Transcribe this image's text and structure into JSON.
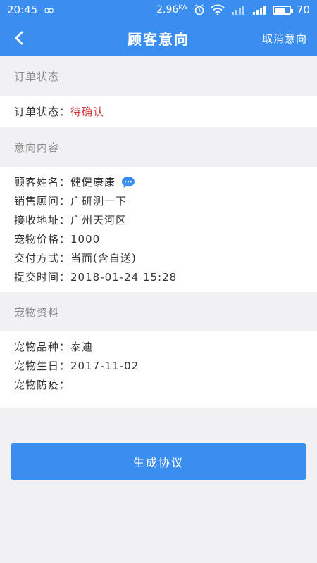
{
  "status_bar": {
    "time": "20:45",
    "infinity": "∞",
    "speed": "2.96",
    "speed_unit": "K/s",
    "battery": "70"
  },
  "header": {
    "title": "顾客意向",
    "action": "取消意向"
  },
  "order_section": {
    "heading": "订单状态",
    "status_label": "订单状态：",
    "status_value": "待确认"
  },
  "intent_section": {
    "heading": "意向内容",
    "rows": [
      {
        "label": "顾客姓名：",
        "value": "健健康康"
      },
      {
        "label": "销售顾问：",
        "value": "广研测一下"
      },
      {
        "label": "接收地址：",
        "value": "广州天河区"
      },
      {
        "label": "宠物价格：",
        "value": "1000"
      },
      {
        "label": "交付方式：",
        "value": "当面(含自送)"
      },
      {
        "label": "提交时间：",
        "value": "2018-01-24 15:28"
      }
    ]
  },
  "pet_section": {
    "heading": "宠物资料",
    "rows": [
      {
        "label": "宠物品种：",
        "value": "泰迪"
      },
      {
        "label": "宠物生日：",
        "value": "2017-11-02"
      },
      {
        "label": "宠物防疫：",
        "value": ""
      }
    ]
  },
  "generate_button": "生成协议",
  "colors": {
    "primary": "#3a8ef0",
    "status_red": "#d0373b"
  }
}
